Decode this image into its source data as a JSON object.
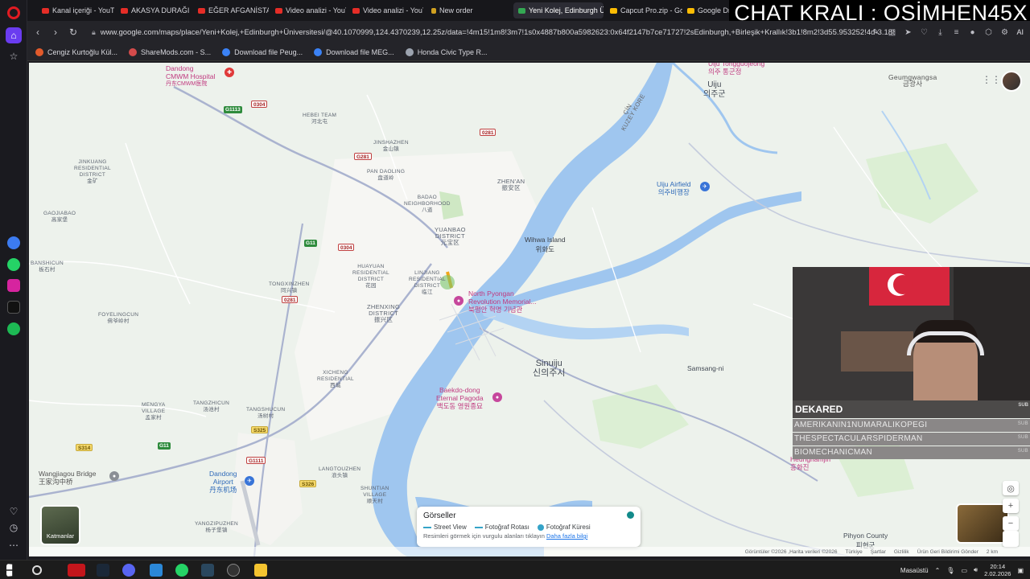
{
  "browser": {
    "tabs": [
      {
        "label": "Kanal içeriği - YouTube",
        "favicon": "youtube-icon"
      },
      {
        "label": "AKASYA DURAĞI 71. Bölüm",
        "favicon": "youtube-icon"
      },
      {
        "label": "EĞER AFGANİSTAN'DA",
        "favicon": "youtube-icon"
      },
      {
        "label": "Video analizi - YouTube",
        "favicon": "youtube-icon"
      },
      {
        "label": "Video analizi - YouTube",
        "favicon": "youtube-icon"
      },
      {
        "label": "New order",
        "favicon": "new-order-icon"
      },
      {
        "label": "Yeni Kolej, Edinburgh Üniv",
        "favicon": "maps-icon"
      },
      {
        "label": "Capcut Pro.zip - Goog",
        "favicon": "drive-icon"
      },
      {
        "label": "Google Drive",
        "favicon": "drive-icon"
      }
    ],
    "url": "www.google.com/maps/place/Yeni+Kolej,+Edinburgh+Üniversitesi/@40.1070999,124.4370239,12.25z/data=!4m15!1m8!3m7!1s0x4887b800a5982623:0x64f2147b7ce71727!2sEdinburgh,+Birleşik+Krallık!3b1!8m2!3d55.953252!4d-3.188267!16zL2",
    "ai_label": "AI",
    "bookmarks": [
      {
        "label": "Cengiz Kurtoğlu Kül...",
        "color": "#e25a2b"
      },
      {
        "label": "ShareMods.com - S...",
        "color": "#d44b4b"
      },
      {
        "label": "Download file Peug...",
        "color": "#3b82f6"
      },
      {
        "label": "Download file MEG...",
        "color": "#3b82f6"
      },
      {
        "label": "Honda Civic Type R...",
        "color": "#9ca3af"
      }
    ]
  },
  "overlay_title": "CHAT KRALI : OSİMHEN45X",
  "map": {
    "labels": {
      "dandong_cmwm": "Dandong\nCMWM Hospital",
      "dandong_cmwm_cn": "丹东CMWM医院",
      "hebei_team": "HEBEI TEAM\n河北屯",
      "jinshazhen": "JINSHAZHEN\n金山镇",
      "jinkuang": "JINKUANG\nRESIDENTIAL\nDISTRICT\n金矿",
      "gaojiabao": "GAOJIABAO\n高家堡",
      "banshicun": "BANSHICUN\n板石村",
      "pan_daoling": "PAN DAOLING\n盘道岭",
      "badao": "BADAO\nNEIGHBORHOOD\n八道",
      "zhen_an": "ZHEN'AN\n振安区",
      "yuanbao": "YUANBAO\nDISTRICT\n元宝区",
      "huayuan": "HUAYUAN\nRESIDENTIAL\nDISTRICT\n花园",
      "linjiang": "LINJIANG\nRESIDENTIAL\nDISTRICT\n临江",
      "tongxinzhen": "TONGXINZHEN\n同兴镇",
      "zhenxing": "ZHENXING\nDISTRICT\n振兴区",
      "foyelingcun": "FOYELINGCUN\n佛爷岭村",
      "xichengzhen": "XICHENG\nRESIDENTIAL\n西城",
      "mengya": "MENGYA\nVILLAGE\n孟家村",
      "tangzhicun": "TANGZHICUN\n汤池村",
      "tangshucun": "TANGSHUCUN\n汤树村",
      "langtouzhen": "LANGTOUZHEN\n浪头镇",
      "shuntian": "SHUNTIAN\nVILLAGE\n顺天村",
      "yangzipuzhen": "YANGZIPUZHEN\n杨子堡镇",
      "wangjiagou": "Wangjiagou Bridge\n王家沟中桥",
      "dandong_airport": "Dandong\nAirport\n丹东机场",
      "uiju": "Uiju\n의주군",
      "uiju_tongguojeong": "Uiju Tongguojeong\n의주 통군정",
      "geumgwangsa": "Geumgwangsa\n금광사",
      "uiju_airfield": "Uiju Airfield\n의주비행장",
      "wihwa": "Wihwa Island\n위화도",
      "north_pyongan": "North Pyongan\nRevolution Memorial...\n북평안 혁명 기념관",
      "sinuiju": "Sinuiju\n신의주시",
      "samsang": "Samsang-ni",
      "baekdo": "Baekdo-dong\nEternal Pagoda\n백도동 영원종묘",
      "hungnam": "Heungnamjin\n흥화진",
      "pihyon": "Pihyon County\n피현군",
      "korea_label": "ÇİN\nKUZEY KORE"
    },
    "road_shields": [
      "G1113",
      "0304",
      "G281",
      "0281",
      "0281",
      "G11",
      "0304",
      "G1111",
      "G11",
      "S314",
      "S326",
      "S326",
      "S325",
      "G11"
    ],
    "layers_label": "Katmanlar",
    "photos": {
      "title": "Görseller",
      "legend": [
        "Street View",
        "Fotoğraf Rotası",
        "Fotoğraf Küresi"
      ],
      "hint": "Resimleri görmek için vurgulu alanları tıklayın",
      "hint_link": "Daha fazla bilgi"
    },
    "footer": [
      "Görüntüler ©2026 ,Harita verileri ©2026",
      "Türkiye",
      "Şartlar",
      "Gizlilik",
      "Ürün Geri Bildirimi Gönder",
      "2 km"
    ],
    "colors": {
      "water": "#9fc6ef",
      "land": "#edf2ec",
      "park": "#cfe8c4",
      "road": "#ffffff",
      "highway": "#9aa4c4"
    }
  },
  "stream": {
    "chat_main": "DEKARED",
    "chat_sub": "SUB",
    "chat_rows": [
      "AMERIKANIN1NUMARALIKOPEGI",
      "THESPECTACULARSPIDERMAN",
      "BIOMECHANICMAN"
    ]
  },
  "taskbar": {
    "desktop_label": "Masaüstü",
    "time": "20:14",
    "date": "2.02.2026"
  }
}
